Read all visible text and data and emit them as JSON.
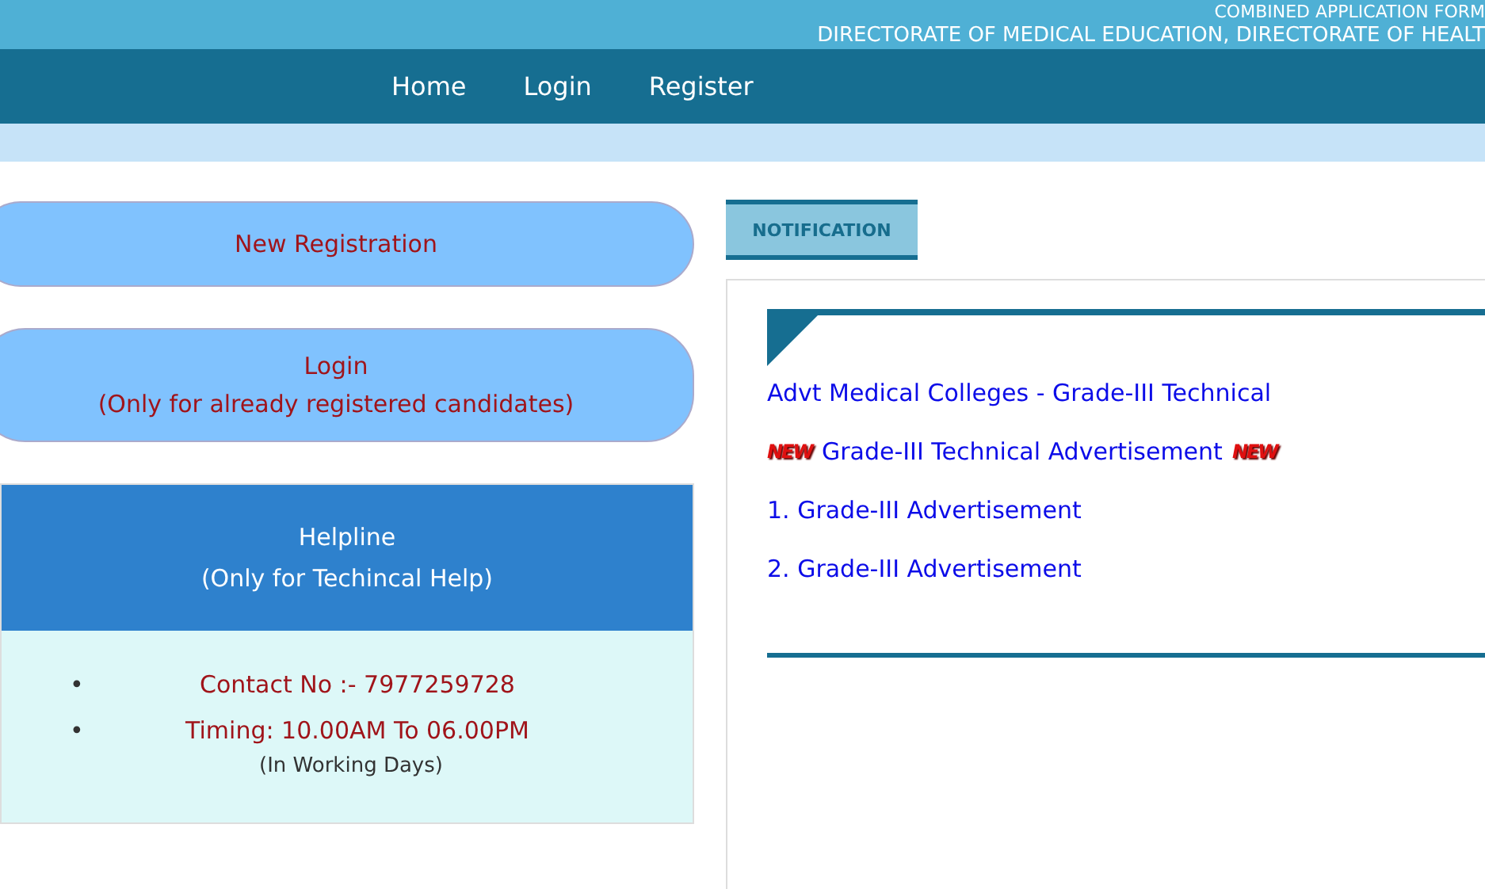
{
  "header": {
    "lines": [
      "COMBINED APPLICATION FORM",
      "DIRECTORATE OF MEDICAL EDUCATION, DIRECTORATE OF HEALT"
    ]
  },
  "nav": [
    "Home",
    "Login",
    "Register"
  ],
  "actions": [
    {
      "lines": [
        "New Registration"
      ]
    },
    {
      "lines": [
        "Login",
        "(Only for already registered candidates)"
      ]
    }
  ],
  "helpline": {
    "title": [
      "Helpline",
      "(Only for Techincal Help)"
    ],
    "items": [
      {
        "bullet": "•",
        "text": "Contact No :- 7977259728"
      },
      {
        "bullet": "•",
        "text": "Timing: 10.00AM To 06.00PM"
      }
    ],
    "note": "(In Working Days)"
  },
  "tabs": [
    {
      "label": "NOTIFICATION",
      "selected": true
    }
  ],
  "notifications": [
    {
      "text": "Advt Medical Colleges - Grade-III Technical"
    },
    {
      "text": "Grade-III Technical Advertisement",
      "badge_before": "NEW",
      "badge_after": "NEW"
    },
    {
      "text": "1. Grade-III Advertisement"
    },
    {
      "text": "2. Grade-III Advertisement"
    }
  ]
}
